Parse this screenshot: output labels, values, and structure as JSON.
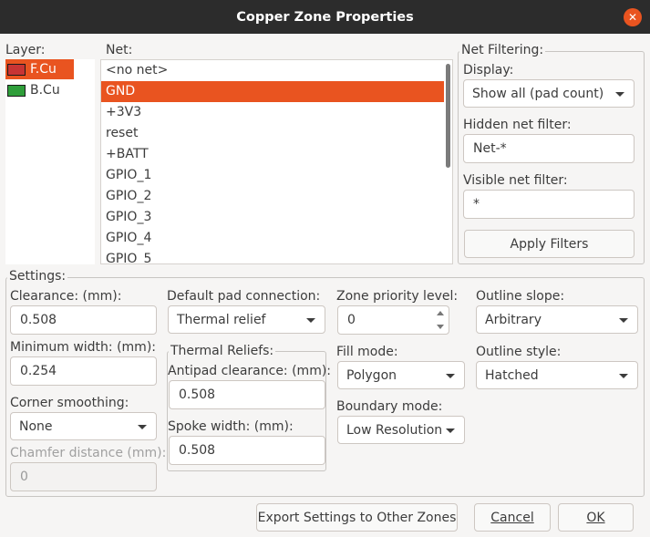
{
  "window": {
    "title": "Copper Zone Properties",
    "close_glyph": "✕"
  },
  "layer": {
    "label": "Layer:",
    "items": [
      {
        "name": "F.Cu",
        "color": "#c83434",
        "selected": true
      },
      {
        "name": "B.Cu",
        "color": "#2f9e3a",
        "selected": false
      }
    ]
  },
  "net": {
    "label": "Net:",
    "items": [
      "<no net>",
      "GND",
      "+3V3",
      "reset",
      "+BATT",
      "GPIO_1",
      "GPIO_2",
      "GPIO_3",
      "GPIO_4",
      "GPIO_5"
    ],
    "selected": "GND"
  },
  "net_filtering": {
    "title": "Net Filtering:",
    "display_label": "Display:",
    "display_value": "Show all (pad count)",
    "hidden_label": "Hidden net filter:",
    "hidden_value": "Net-*",
    "visible_label": "Visible net filter:",
    "visible_value": "*",
    "apply_button": "Apply Filters"
  },
  "settings": {
    "title": "Settings:",
    "clearance_label": "Clearance: (mm):",
    "clearance_value": "0.508",
    "min_width_label": "Minimum width: (mm):",
    "min_width_value": "0.254",
    "corner_label": "Corner smoothing:",
    "corner_value": "None",
    "chamfer_label": "Chamfer distance (mm):",
    "chamfer_value": "0",
    "pad_conn_label": "Default pad connection:",
    "pad_conn_value": "Thermal relief",
    "thermal_title": "Thermal Reliefs:",
    "antipad_label": "Antipad clearance: (mm):",
    "antipad_value": "0.508",
    "spoke_label": "Spoke width: (mm):",
    "spoke_value": "0.508",
    "priority_label": "Zone priority level:",
    "priority_value": "0",
    "fill_label": "Fill mode:",
    "fill_value": "Polygon",
    "boundary_label": "Boundary mode:",
    "boundary_value": "Low Resolution",
    "slope_label": "Outline slope:",
    "slope_value": "Arbitrary",
    "style_label": "Outline style:",
    "style_value": "Hatched"
  },
  "footer": {
    "export_button": "Export Settings to Other Zones",
    "cancel_button": "Cancel",
    "ok_button": "OK"
  }
}
